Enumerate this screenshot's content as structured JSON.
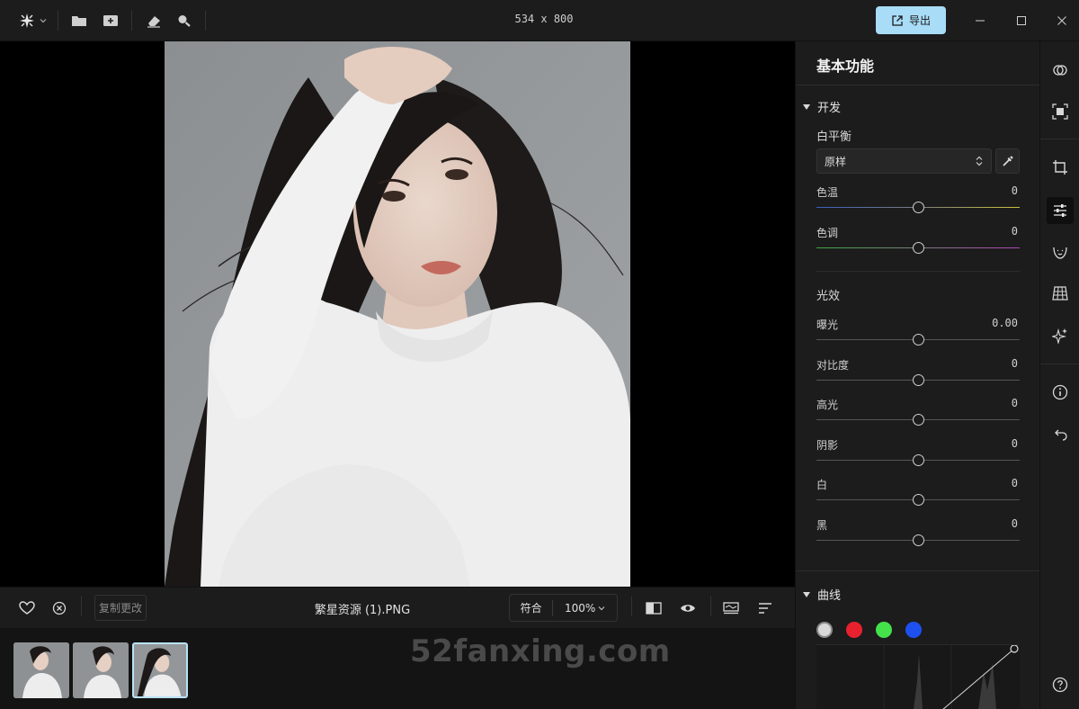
{
  "topbar": {
    "dimensions": "534 x 800",
    "export_label": "导出"
  },
  "bottombar": {
    "copy_changes": "复制更改",
    "filename": "繁星资源 (1).PNG",
    "fit_label": "符合",
    "zoom_label": "100%"
  },
  "watermark": "52fanxing.com",
  "panel": {
    "title": "基本功能",
    "develop": {
      "heading": "开发",
      "white_balance": {
        "heading": "白平衡",
        "preset": "原样",
        "temperature": {
          "label": "色温",
          "value": "0"
        },
        "tint": {
          "label": "色调",
          "value": "0"
        }
      },
      "light": {
        "heading": "光效",
        "exposure": {
          "label": "曝光",
          "value": "0.00"
        },
        "contrast": {
          "label": "对比度",
          "value": "0"
        },
        "highlights": {
          "label": "高光",
          "value": "0"
        },
        "shadows": {
          "label": "阴影",
          "value": "0"
        },
        "whites": {
          "label": "白",
          "value": "0"
        },
        "blacks": {
          "label": "黑",
          "value": "0"
        }
      }
    },
    "curves": {
      "heading": "曲线",
      "channels": [
        "#d9d9d9",
        "#e8212f",
        "#44e14a",
        "#1e50f0"
      ]
    }
  },
  "colors": {
    "accent": "#a8dcf7",
    "background": "#1c1c1c",
    "canvas": "#000000"
  }
}
